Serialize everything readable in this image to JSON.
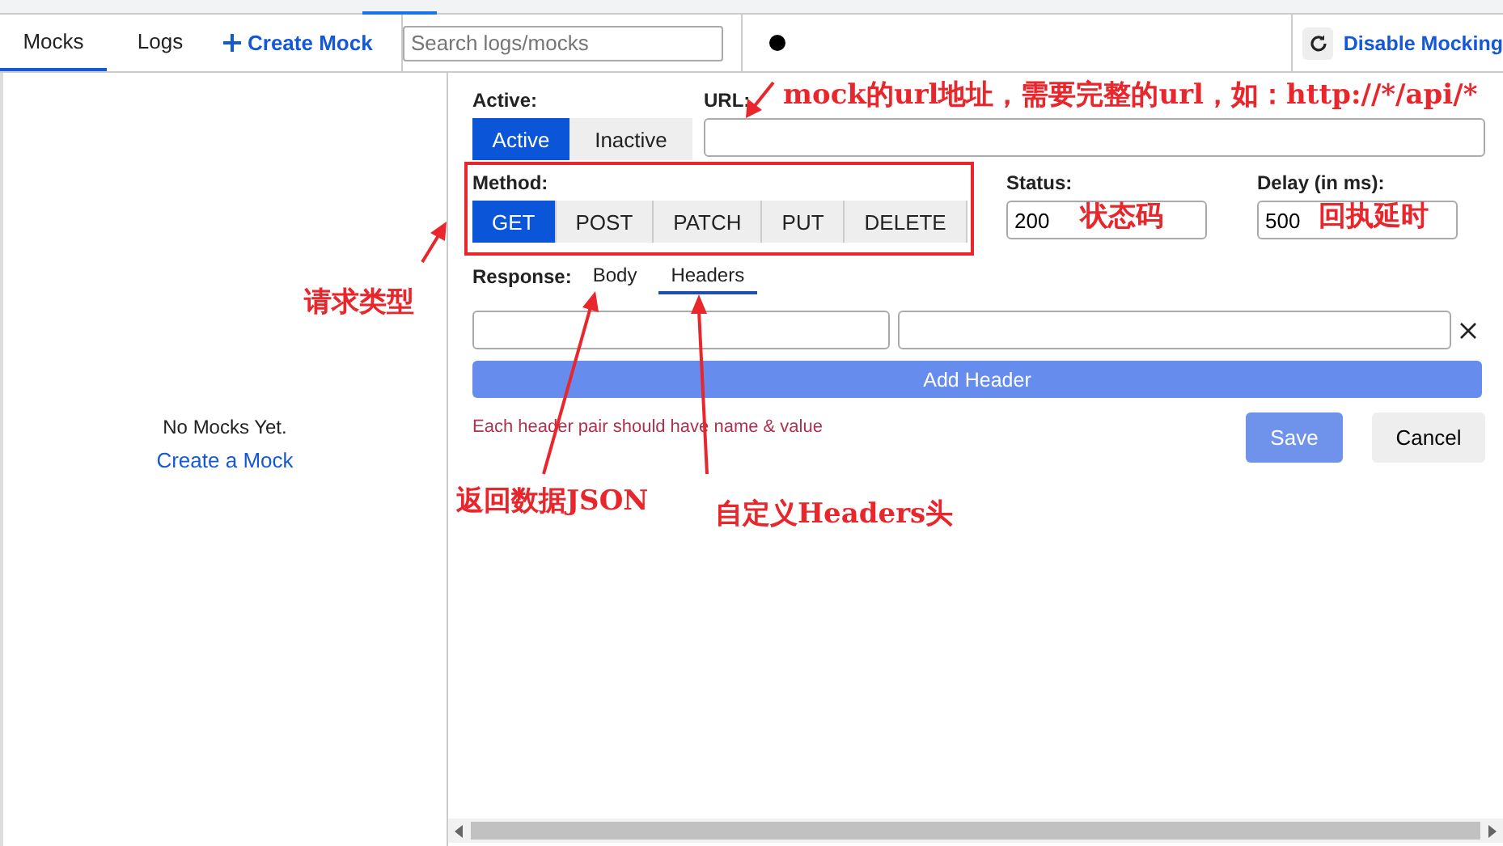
{
  "toolbar": {
    "tabs": [
      {
        "label": "Mocks",
        "selected": true
      },
      {
        "label": "Logs",
        "selected": false
      }
    ],
    "create_button": "Create Mock",
    "search": {
      "placeholder": "Search logs/mocks"
    },
    "disable_button": "Disable Mocking"
  },
  "sidebar": {
    "empty_message": "No Mocks Yet.",
    "create_link": "Create a Mock"
  },
  "form": {
    "active": {
      "label": "Active:",
      "options": [
        {
          "label": "Active",
          "selected": true
        },
        {
          "label": "Inactive",
          "selected": false
        }
      ]
    },
    "url": {
      "label": "URL:"
    },
    "method": {
      "label": "Method:",
      "options": [
        {
          "label": "GET",
          "selected": true
        },
        {
          "label": "POST",
          "selected": false
        },
        {
          "label": "PATCH",
          "selected": false
        },
        {
          "label": "PUT",
          "selected": false
        },
        {
          "label": "DELETE",
          "selected": false
        }
      ]
    },
    "status": {
      "label": "Status:",
      "value": "200"
    },
    "delay": {
      "label": "Delay (in ms):",
      "value": "500"
    },
    "response": {
      "label": "Response:",
      "tabs": [
        {
          "label": "Body",
          "selected": false
        },
        {
          "label": "Headers",
          "selected": true
        }
      ]
    },
    "add_header_button": "Add Header",
    "error": "Each header pair should have name & value",
    "save_button": "Save",
    "cancel_button": "Cancel"
  },
  "annotations": [
    {
      "text": "mock的url地址，需要完整的url，如：http://*/api/*"
    },
    {
      "text": "请求类型"
    },
    {
      "text": "状态码"
    },
    {
      "text": "回执延时"
    },
    {
      "text": "返回数据JSON"
    },
    {
      "text": "自定义Headers头"
    }
  ]
}
